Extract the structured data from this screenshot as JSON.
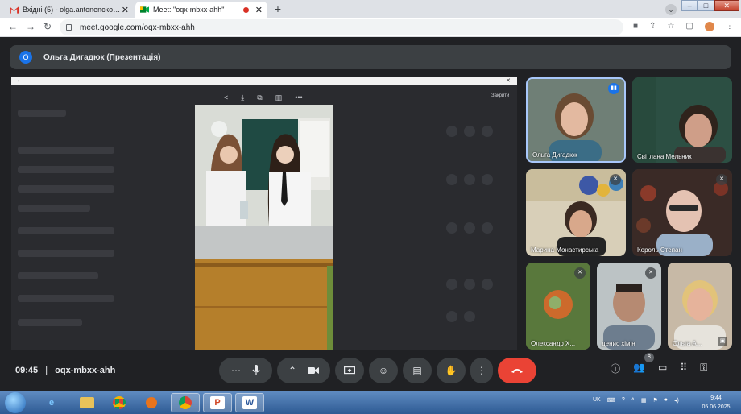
{
  "browser": {
    "tabs": [
      {
        "label": "Вхідні (5) - olga.antonencko@gm",
        "icon": "gmail-icon"
      },
      {
        "label": "Meet: \"oqx-mbxx-ahh\"",
        "icon": "meet-icon",
        "recording": true
      }
    ],
    "url": "meet.google.com/oqx-mbxx-ahh"
  },
  "meet": {
    "presenter_initial": "О",
    "presenter_title": "Ольга Дигадюк (Презентація)",
    "viewer_close_label": "Закрити",
    "participants": [
      {
        "name": "Ольга Дигадюк",
        "status": "speaking"
      },
      {
        "name": "Світлана Мельник",
        "status": ""
      },
      {
        "name": "Марина Монастирська",
        "status": "muted"
      },
      {
        "name": "Король Степан",
        "status": "muted"
      },
      {
        "name": "Олександр Х...",
        "status": "muted"
      },
      {
        "name": "денис хімін",
        "status": "muted"
      },
      {
        "name": "Ольга А...",
        "status": ""
      }
    ],
    "time": "09:45",
    "meeting_code": "oqx-mbxx-ahh",
    "separator": "|",
    "people_count": "8"
  },
  "taskbar": {
    "language": "UK",
    "time": "9:44",
    "date": "05.06.2025",
    "apps": [
      "start",
      "ie",
      "explorer",
      "chrome",
      "media-player",
      "chrome-active",
      "powerpoint",
      "word"
    ]
  },
  "colors": {
    "meet_bg": "#202124",
    "leave_red": "#ea4335",
    "accent_blue": "#1a73e8"
  }
}
